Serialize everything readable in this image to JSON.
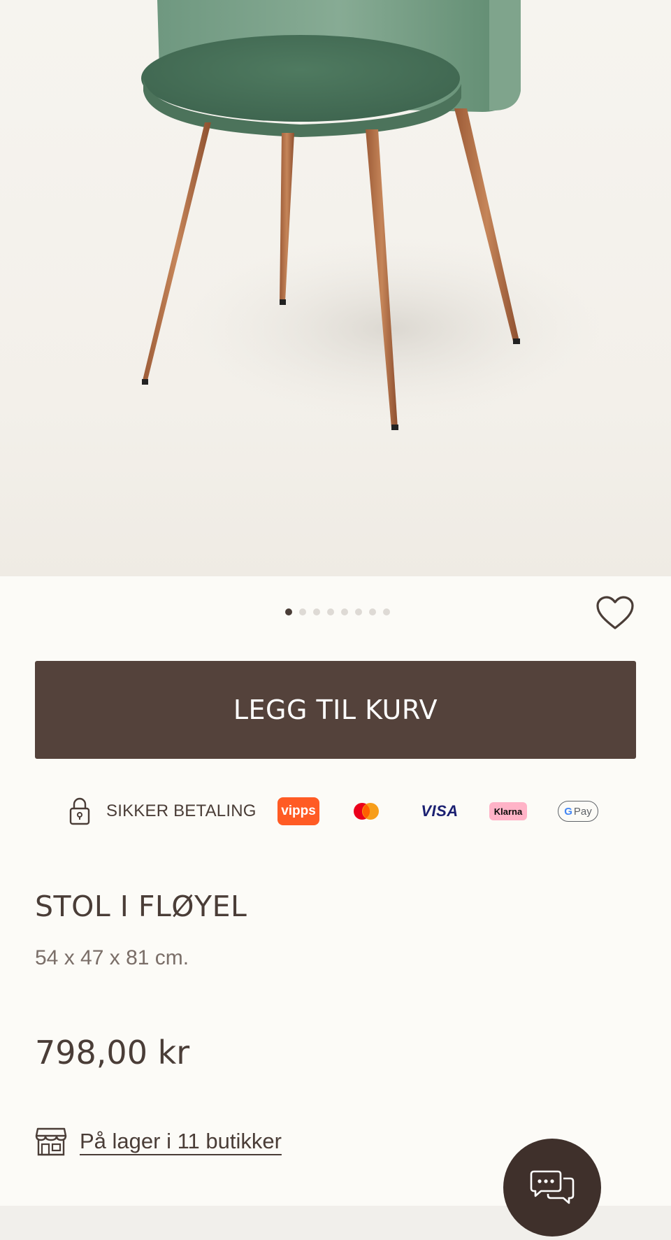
{
  "product_image": {
    "alt": "Grønn fløyelsstol med tre-look ben"
  },
  "gallery": {
    "total_images": 8,
    "active_index": 0
  },
  "actions": {
    "add_to_cart_label": "LEGG TIL KURV"
  },
  "payment": {
    "secure_label": "SIKKER BETALING",
    "methods": [
      "vipps",
      "mastercard",
      "visa",
      "klarna",
      "google-pay"
    ],
    "vipps_label": "vipps",
    "visa_label": "VISA",
    "klarna_label": "Klarna",
    "gpay_label": "Pay",
    "gpay_g": "G"
  },
  "product": {
    "name": "STOL I FLØYEL",
    "dimensions": "54 x 47 x 81 cm.",
    "price": "798,00 kr"
  },
  "stock": {
    "label": "På lager i 11 butikker"
  },
  "colors": {
    "brand_brown": "#54423b",
    "text": "#4a3d37",
    "chat_bg": "#3f302b",
    "chair_velvet": "#5f8a6e",
    "chair_legs": "#b6724a"
  }
}
